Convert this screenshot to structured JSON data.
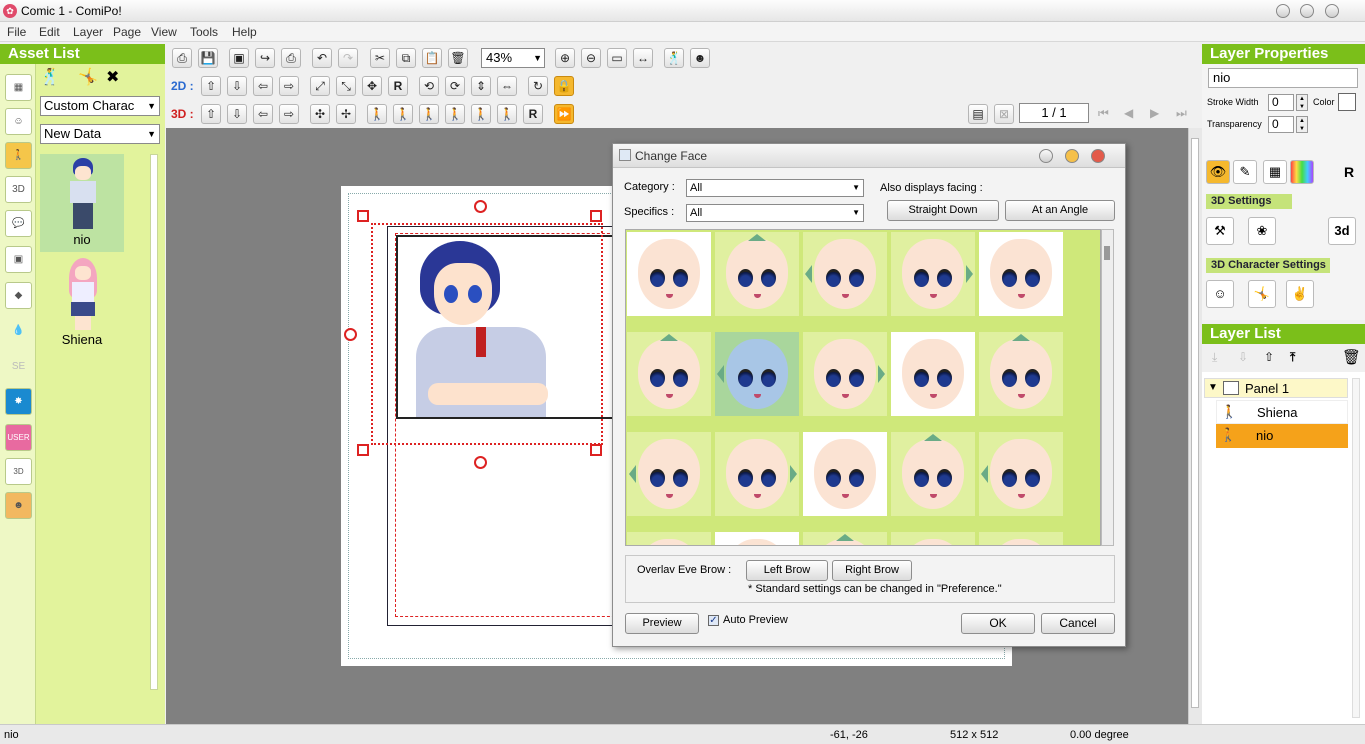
{
  "window": {
    "title": "Comic 1 - ComiPo!",
    "icon": "comipo-logo-icon"
  },
  "menu": [
    "File",
    "Edit",
    "Layer",
    "Page",
    "View",
    "Tools",
    "Help"
  ],
  "asset_list": {
    "title": "Asset List",
    "dropdown_1": "Custom Charac",
    "dropdown_2": "New Data",
    "characters": [
      {
        "name": "nio"
      },
      {
        "name": "Shiena"
      }
    ]
  },
  "toolbar": {
    "zoom": "43%",
    "row2_label": "2D :",
    "row3_label": "3D :",
    "page": "1 / 1"
  },
  "dialog": {
    "title": "Change Face",
    "category_label": "Category :",
    "category_value": "All",
    "specifics_label": "Specifics :",
    "specifics_value": "All",
    "facing_label": "Also displays facing :",
    "straight_down": "Straight Down",
    "at_an_angle": "At an Angle",
    "overlay_label": "Overlav Eve Brow :",
    "left_brow": "Left Brow",
    "right_brow": "Right Brow",
    "note": "* Standard settings can be changed in \"Preference.\"",
    "preview": "Preview",
    "auto_preview": "Auto Preview",
    "auto_preview_checked": true,
    "ok": "OK",
    "cancel": "Cancel"
  },
  "layer_properties": {
    "title": "Layer Properties",
    "name": "nio",
    "stroke_width_label": "Stroke Width",
    "stroke_width": "0",
    "color_label": "Color",
    "transparency_label": "Transparency",
    "transparency": "0",
    "settings_3d": "3D Settings",
    "character_settings_3d": "3D Character Settings"
  },
  "layer_list": {
    "title": "Layer List",
    "panel": "Panel 1",
    "layers": [
      "Shiena",
      "nio"
    ],
    "selected": "nio"
  },
  "status": {
    "name": "nio",
    "coords": "-61, -26",
    "size": "512 x 512",
    "rotation": "0.00 degree"
  },
  "colors": {
    "accent_green": "#7bbf1a",
    "selection_orange": "#f5b82e",
    "grid_green": "#cfe87a"
  }
}
